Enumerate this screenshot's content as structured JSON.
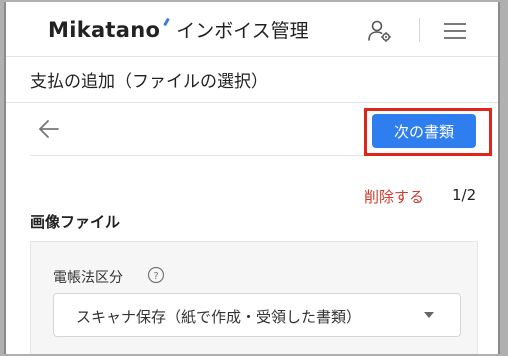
{
  "header": {
    "brand": "Mikatano",
    "app_name": "インボイス管理",
    "icons": [
      "user-settings-icon",
      "hamburger-menu-icon"
    ]
  },
  "page": {
    "title": "支払の追加（ファイルの選択）"
  },
  "actions": {
    "back_icon": "arrow-left-icon",
    "next_button": "次の書類",
    "highlight_color": "#e0261b",
    "primary_color": "#2f7ef0"
  },
  "file": {
    "delete_label": "削除する",
    "page_counter": "1/2",
    "section_title": "画像ファイル"
  },
  "form": {
    "ebook_law_label": "電帳法区分",
    "help_icon": "question-circle-icon",
    "ebook_law_value": "スキャナ保存（紙で作成・受領した書類）"
  }
}
